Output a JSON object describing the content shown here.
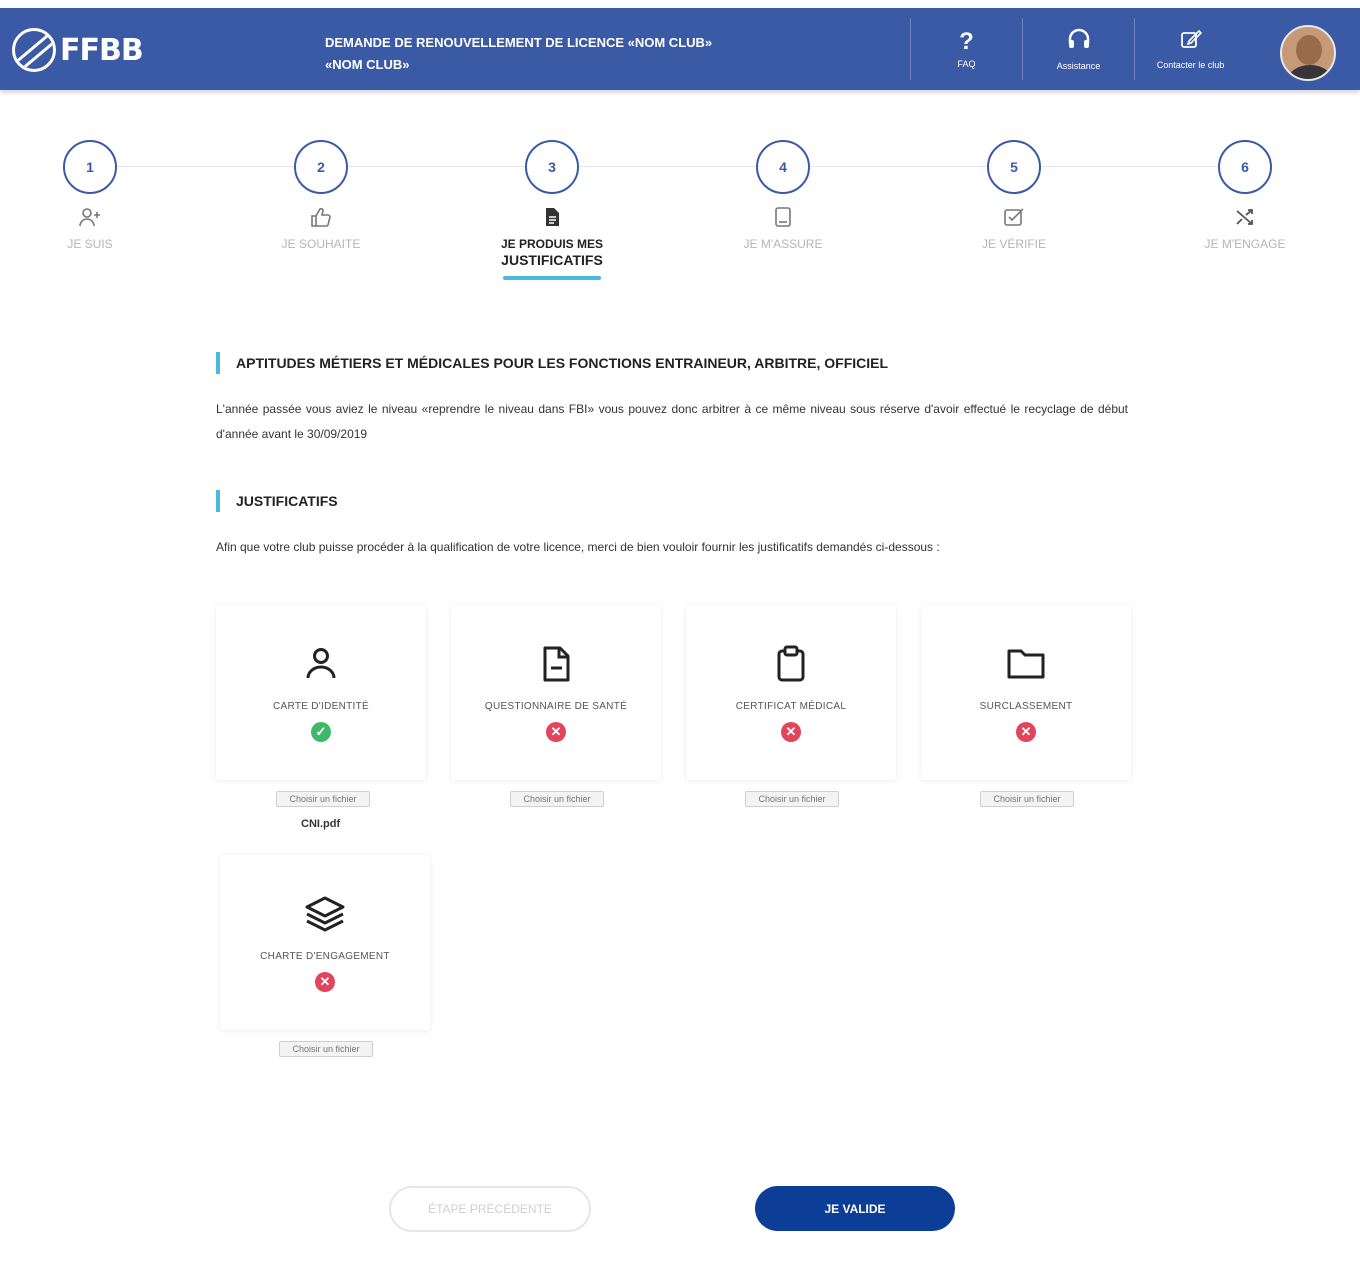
{
  "header": {
    "logo_text": "FFBB",
    "title_line1": "DEMANDE DE RENOUVELLEMENT DE LICENCE «NOM CLUB»",
    "title_line2": "«NOM CLUB»",
    "actions": [
      {
        "icon": "question-icon",
        "label": "FAQ"
      },
      {
        "icon": "headset-icon",
        "label": "Assistance"
      },
      {
        "icon": "edit-icon",
        "label": "Contacter le club"
      }
    ]
  },
  "steps": [
    {
      "number": "1",
      "label": "JE SUIS",
      "icon": "user-add-icon",
      "active": false
    },
    {
      "number": "2",
      "label": "JE SOUHAITE",
      "icon": "thumbs-up-icon",
      "active": false
    },
    {
      "number": "3",
      "label_line1": "JE PRODUIS MES",
      "label_line2": "JUSTIFICATIFS",
      "icon": "document-icon",
      "active": true
    },
    {
      "number": "4",
      "label": "JE M'ASSURE",
      "icon": "tablet-icon",
      "active": false
    },
    {
      "number": "5",
      "label": "JE VÉRIFIE",
      "icon": "checkbox-edit-icon",
      "active": false
    },
    {
      "number": "6",
      "label": "JE M'ENGAGE",
      "icon": "shuffle-icon",
      "active": false
    }
  ],
  "section1": {
    "title": "APTITUDES MÉTIERS ET MÉDICALES POUR LES FONCTIONS ENTRAINEUR, ARBITRE, OFFICIEL",
    "text": "L'année passée vous aviez le niveau «reprendre le niveau dans FBI» vous pouvez donc arbitrer à ce même niveau sous réserve d'avoir effectué le recyclage de début d'année avant le 30/09/2019"
  },
  "section2": {
    "title": "JUSTIFICATIFS",
    "text": "Afin que votre club puisse procéder à la qualification de votre licence, merci de bien vouloir fournir les justificatifs demandés ci-dessous :"
  },
  "documents": [
    {
      "label": "CARTE D'IDENTITÉ",
      "icon": "user-icon",
      "status": "ok",
      "status_glyph": "✓",
      "button": "Choisir un fichier",
      "file": "CNI.pdf"
    },
    {
      "label": "QUESTIONNAIRE DE SANTÉ",
      "icon": "file-minus-icon",
      "status": "ko",
      "status_glyph": "✕",
      "button": "Choisir un fichier"
    },
    {
      "label": "CERTIFICAT MÉDICAL",
      "icon": "clipboard-icon",
      "status": "ko",
      "status_glyph": "✕",
      "button": "Choisir un fichier"
    },
    {
      "label": "SURCLASSEMENT",
      "icon": "folder-icon",
      "status": "ko",
      "status_glyph": "✕",
      "button": "Choisir un fichier"
    },
    {
      "label": "CHARTE D'ENGAGEMENT",
      "icon": "layers-icon",
      "status": "ko",
      "status_glyph": "✕",
      "button": "Choisir un fichier"
    }
  ],
  "footer": {
    "prev_label": "ÉTAPE PRÉCÉDENTE",
    "validate_label": "JE VALIDE"
  },
  "colors": {
    "header_bg": "#3a5aa6",
    "accent": "#4cb8e2",
    "primary_button": "#0c3d97",
    "ok": "#3fb86c",
    "error": "#e2445c"
  }
}
